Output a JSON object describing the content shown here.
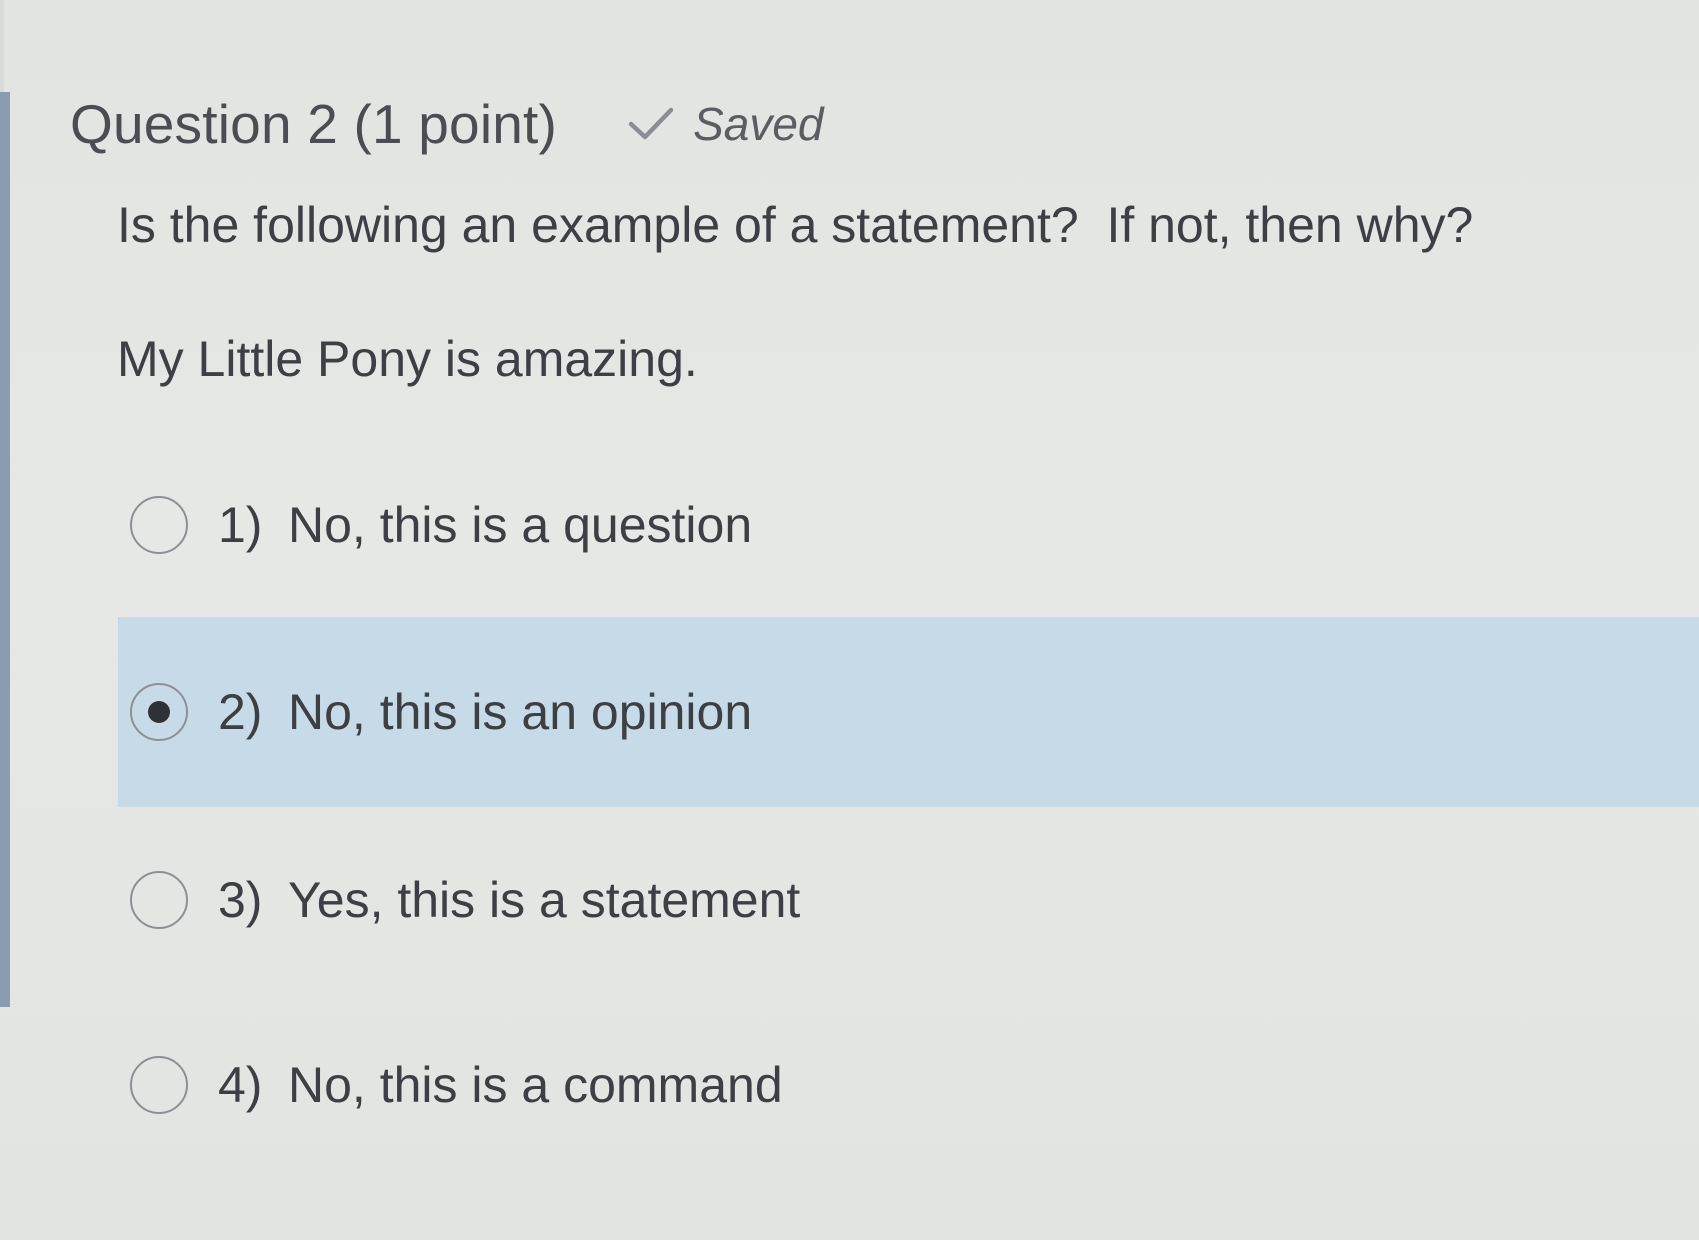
{
  "question": {
    "title": "Question 2 (1 point)",
    "status_label": "Saved",
    "status_icon": "check-icon",
    "prompt": "Is the following an example of a statement?  If not, then why?",
    "subject": "My Little Pony is amazing."
  },
  "options": [
    {
      "number": "1)",
      "label": "No, this is a question",
      "selected": false
    },
    {
      "number": "2)",
      "label": "No, this is an opinion",
      "selected": true
    },
    {
      "number": "3)",
      "label": "Yes, this is a statement",
      "selected": false
    },
    {
      "number": "4)",
      "label": "No, this is a command",
      "selected": false
    }
  ],
  "colors": {
    "selected_background": "#c6dbe7",
    "left_bar": "#8a9bb2",
    "background": "#e4e6e4"
  }
}
